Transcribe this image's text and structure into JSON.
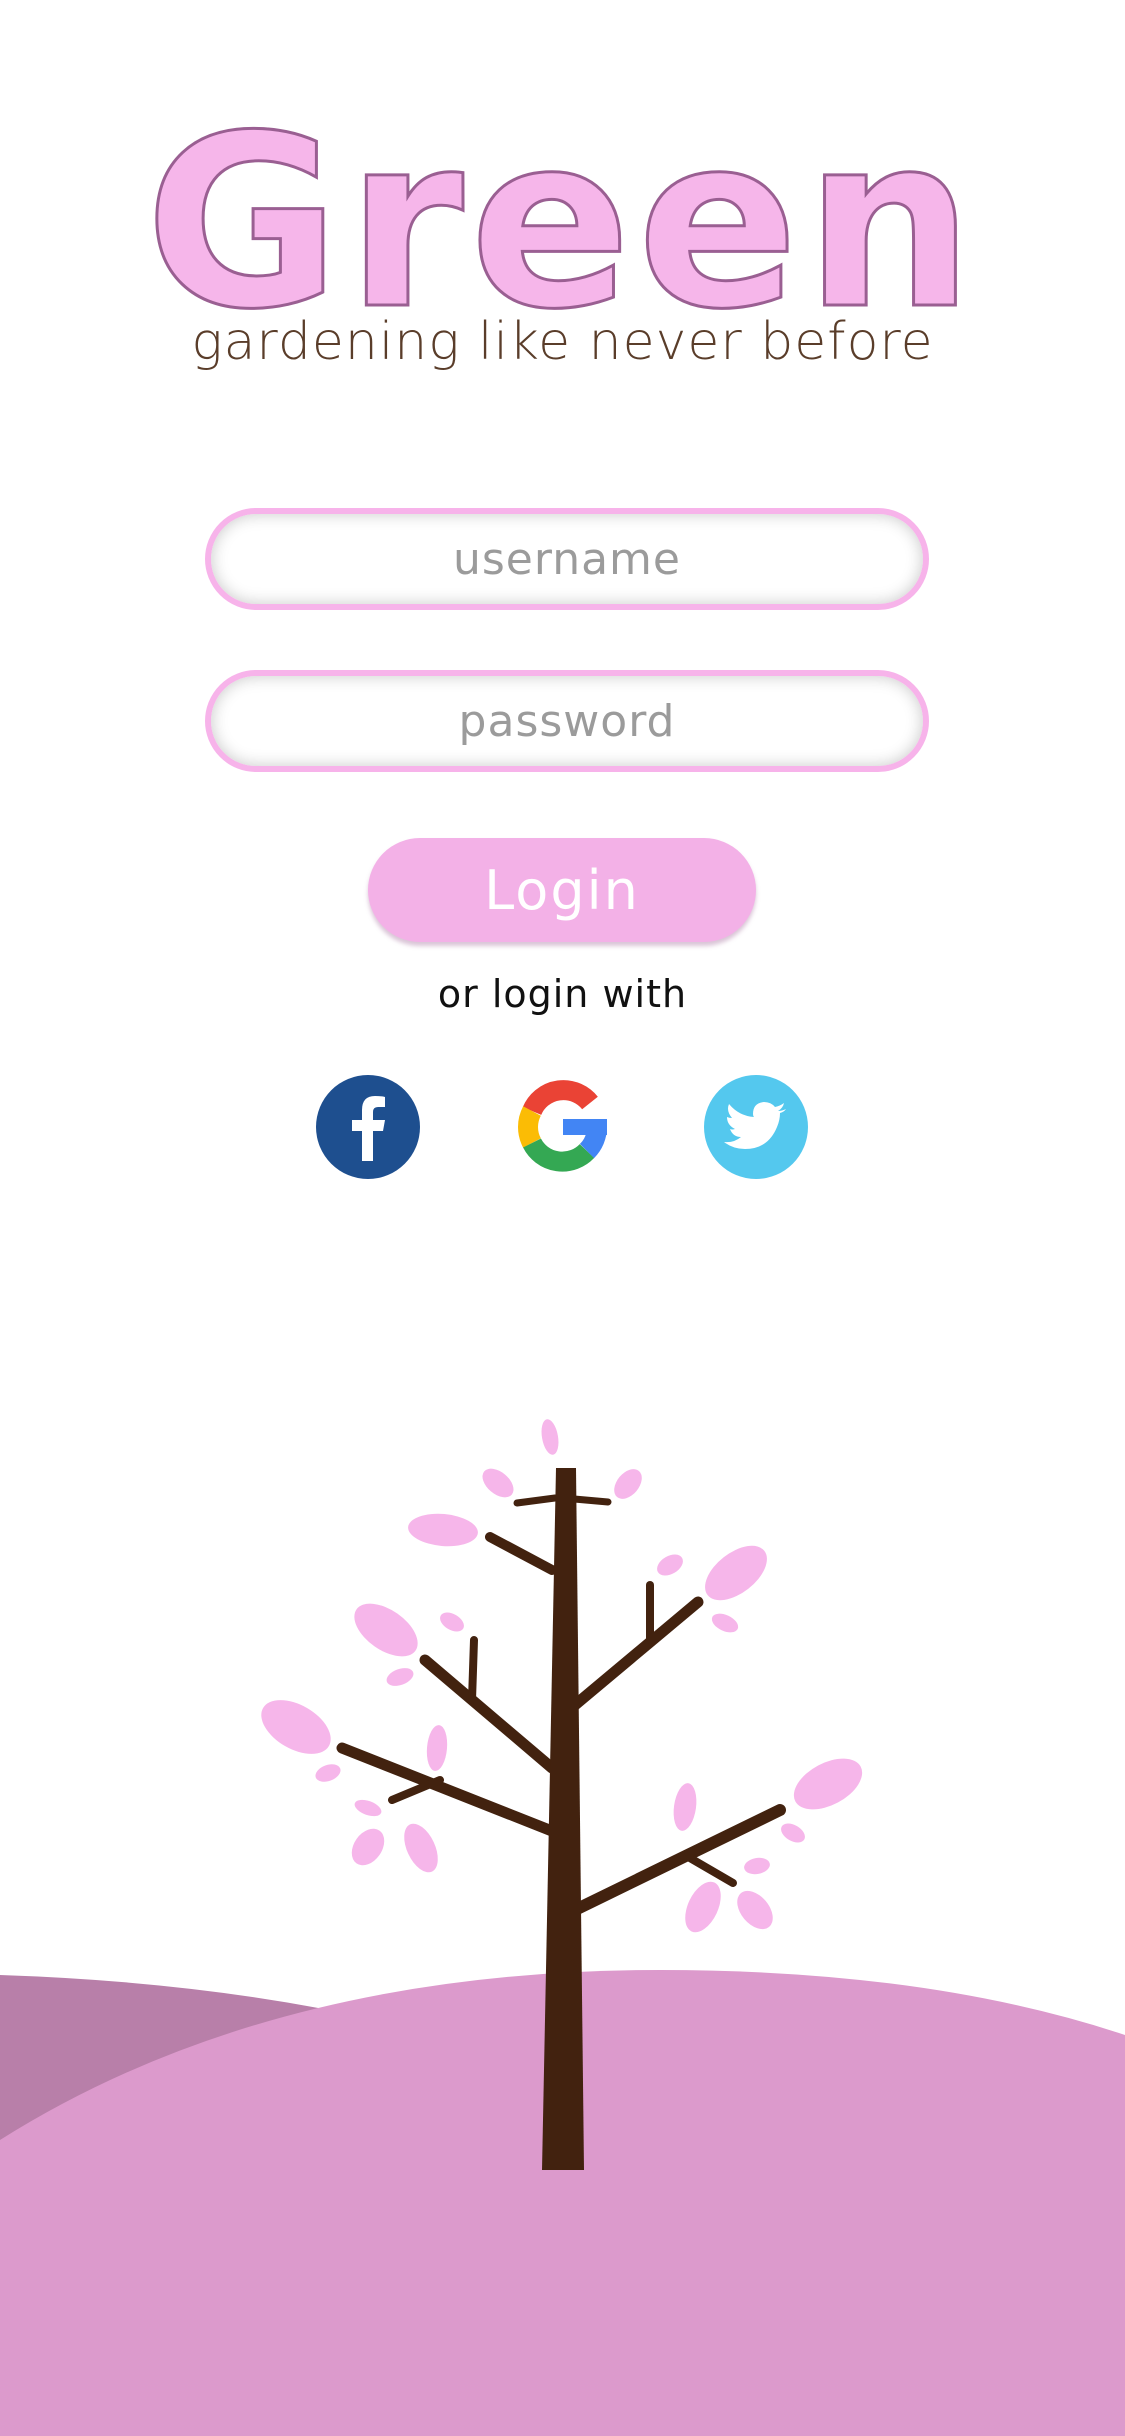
{
  "brand": {
    "title": "Green",
    "tagline": "gardening like never before"
  },
  "form": {
    "username_placeholder": "username",
    "password_placeholder": "password",
    "login_label": "Login",
    "alt_login_text": "or login with"
  },
  "social": [
    {
      "name": "Facebook",
      "icon": "facebook-icon"
    },
    {
      "name": "Google",
      "icon": "google-icon"
    },
    {
      "name": "Twitter",
      "icon": "twitter-icon"
    }
  ],
  "colors": {
    "accent_pink": "#f6b6ea",
    "title_outline": "#9a5f92",
    "tagline": "#5a3d2a",
    "hill_front": "#dc9acc",
    "hill_back": "#b87fa9",
    "trunk": "#42220f",
    "leaves": "#f6b6ea",
    "facebook": "#1e4f8f",
    "twitter": "#54c8ee"
  }
}
